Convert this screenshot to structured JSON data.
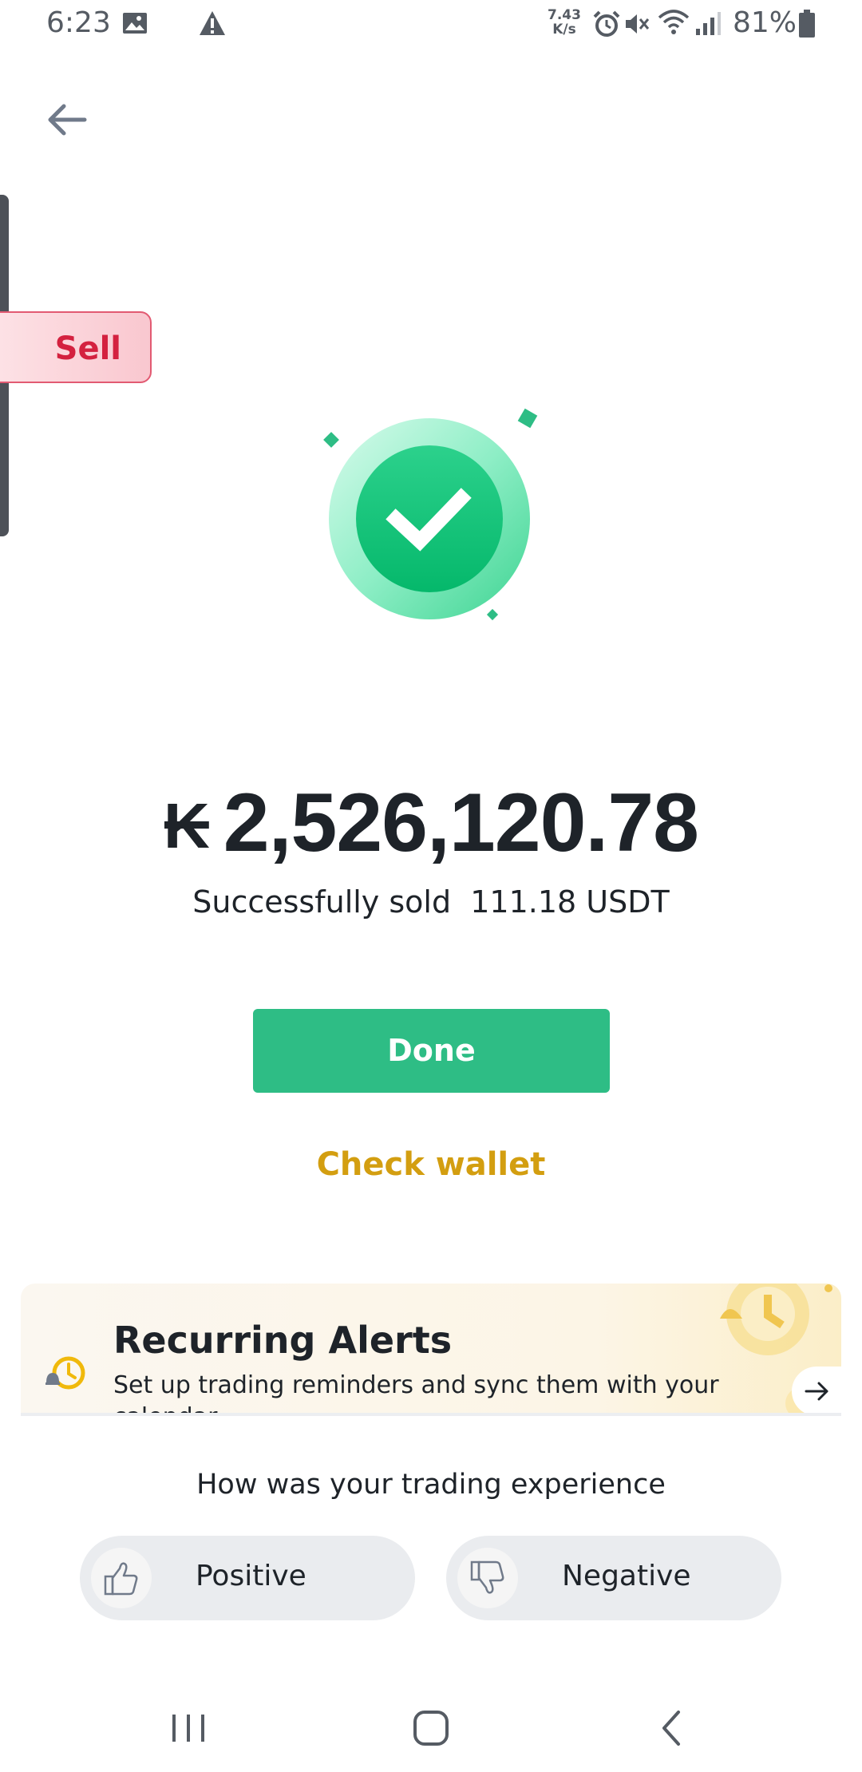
{
  "status_bar": {
    "time": "6:23",
    "net_speed_value": "7.43",
    "net_speed_unit": "K/s",
    "battery": "81%",
    "icons": [
      "gallery-icon",
      "warning-icon",
      "alarm-icon",
      "mute-icon",
      "wifi-icon",
      "signal-icon",
      "battery-icon"
    ]
  },
  "side_tab": {
    "label": "Sell"
  },
  "result": {
    "currency_symbol": "₭",
    "amount": "2,526,120.78",
    "message": "Successfully sold  111.18 USDT"
  },
  "actions": {
    "done_label": "Done",
    "check_wallet_label": "Check wallet"
  },
  "banner": {
    "title": "Recurring Alerts",
    "description": "Set up trading reminders and sync them with your calendar"
  },
  "feedback": {
    "question": "How was your trading experience",
    "positive_label": "Positive",
    "negative_label": "Negative"
  },
  "colors": {
    "success_green": "#2ebd85",
    "accent_yellow": "#d39e10",
    "sell_red": "#d4213f"
  },
  "nav_bar": {
    "icons": [
      "recent-apps-icon",
      "home-icon",
      "back-icon"
    ]
  }
}
